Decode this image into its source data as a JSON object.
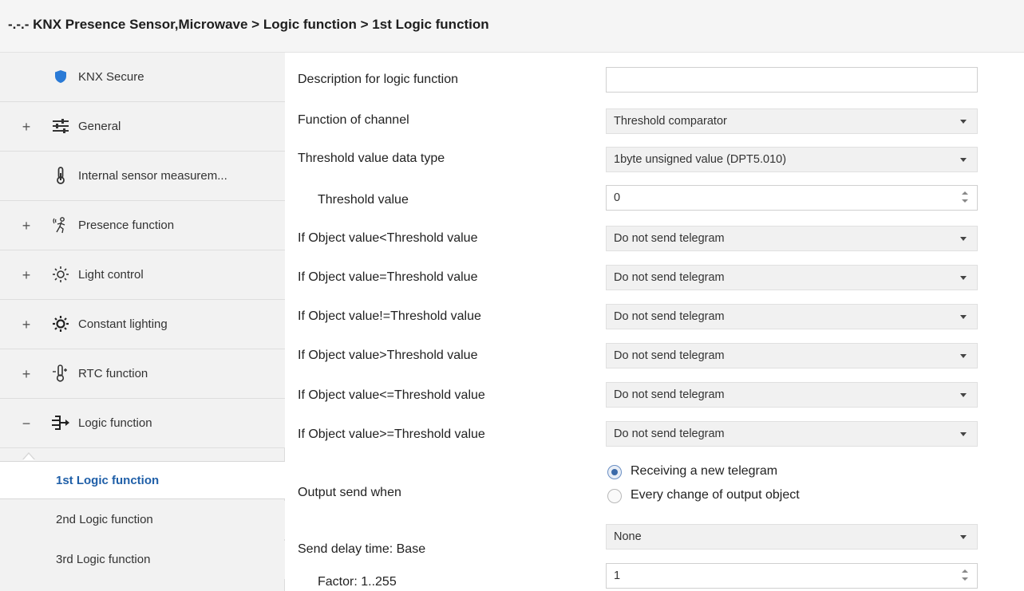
{
  "window": {
    "title": "-.-.- KNX Presence Sensor,Microwave > Logic function > 1st Logic function"
  },
  "sidebar": {
    "items": [
      {
        "label": "KNX Secure",
        "icon": "shield-icon",
        "expandable": false
      },
      {
        "label": "General",
        "icon": "sliders-icon",
        "expandable": true,
        "expander": "+"
      },
      {
        "label": "Internal sensor measurem...",
        "icon": "thermometer-icon",
        "expandable": false
      },
      {
        "label": "Presence function",
        "icon": "person-motion-icon",
        "expandable": true,
        "expander": "+"
      },
      {
        "label": "Light control",
        "icon": "sun-icon",
        "expandable": true,
        "expander": "+"
      },
      {
        "label": "Constant lighting",
        "icon": "sun-bold-icon",
        "expandable": true,
        "expander": "+"
      },
      {
        "label": "RTC function",
        "icon": "rtc-thermometer-icon",
        "expandable": true,
        "expander": "+"
      },
      {
        "label": "Logic function",
        "icon": "logic-gate-icon",
        "expandable": true,
        "expander": "−"
      }
    ],
    "sub_items": [
      {
        "label": "1st Logic function",
        "active": true
      },
      {
        "label": "2nd Logic function",
        "active": false
      },
      {
        "label": "3rd Logic function",
        "active": false
      }
    ]
  },
  "params": {
    "description": {
      "label": "Description for logic function",
      "value": ""
    },
    "function_of_channel": {
      "label": "Function of channel",
      "value": "Threshold comparator"
    },
    "threshold_type": {
      "label": "Threshold value data type",
      "value": "1byte unsigned value (DPT5.010)"
    },
    "threshold_value": {
      "label": "Threshold value",
      "value": "0"
    },
    "if_lt": {
      "label": "If Object value<Threshold value",
      "value": "Do not send telegram"
    },
    "if_eq": {
      "label": "If Object value=Threshold value",
      "value": "Do not send telegram"
    },
    "if_ne": {
      "label": "If Object value!=Threshold value",
      "value": "Do not send telegram"
    },
    "if_gt": {
      "label": "If Object value>Threshold value",
      "value": "Do not send telegram"
    },
    "if_le": {
      "label": "If Object value<=Threshold value",
      "value": "Do not send telegram"
    },
    "if_ge": {
      "label": "If Object value>=Threshold value",
      "value": "Do not send telegram"
    },
    "output_send_when": {
      "label": "Output send when",
      "options": [
        {
          "label": "Receiving a new telegram",
          "checked": true
        },
        {
          "label": "Every change of output object",
          "checked": false
        }
      ]
    },
    "send_delay_base": {
      "label": "Send delay time: Base",
      "value": "None"
    },
    "factor": {
      "label": "Factor: 1..255",
      "value": "1"
    }
  },
  "colors": {
    "active_link": "#1f5fa8",
    "sidebar_bg": "#f2f2f2",
    "shield": "#2a7ad6"
  }
}
